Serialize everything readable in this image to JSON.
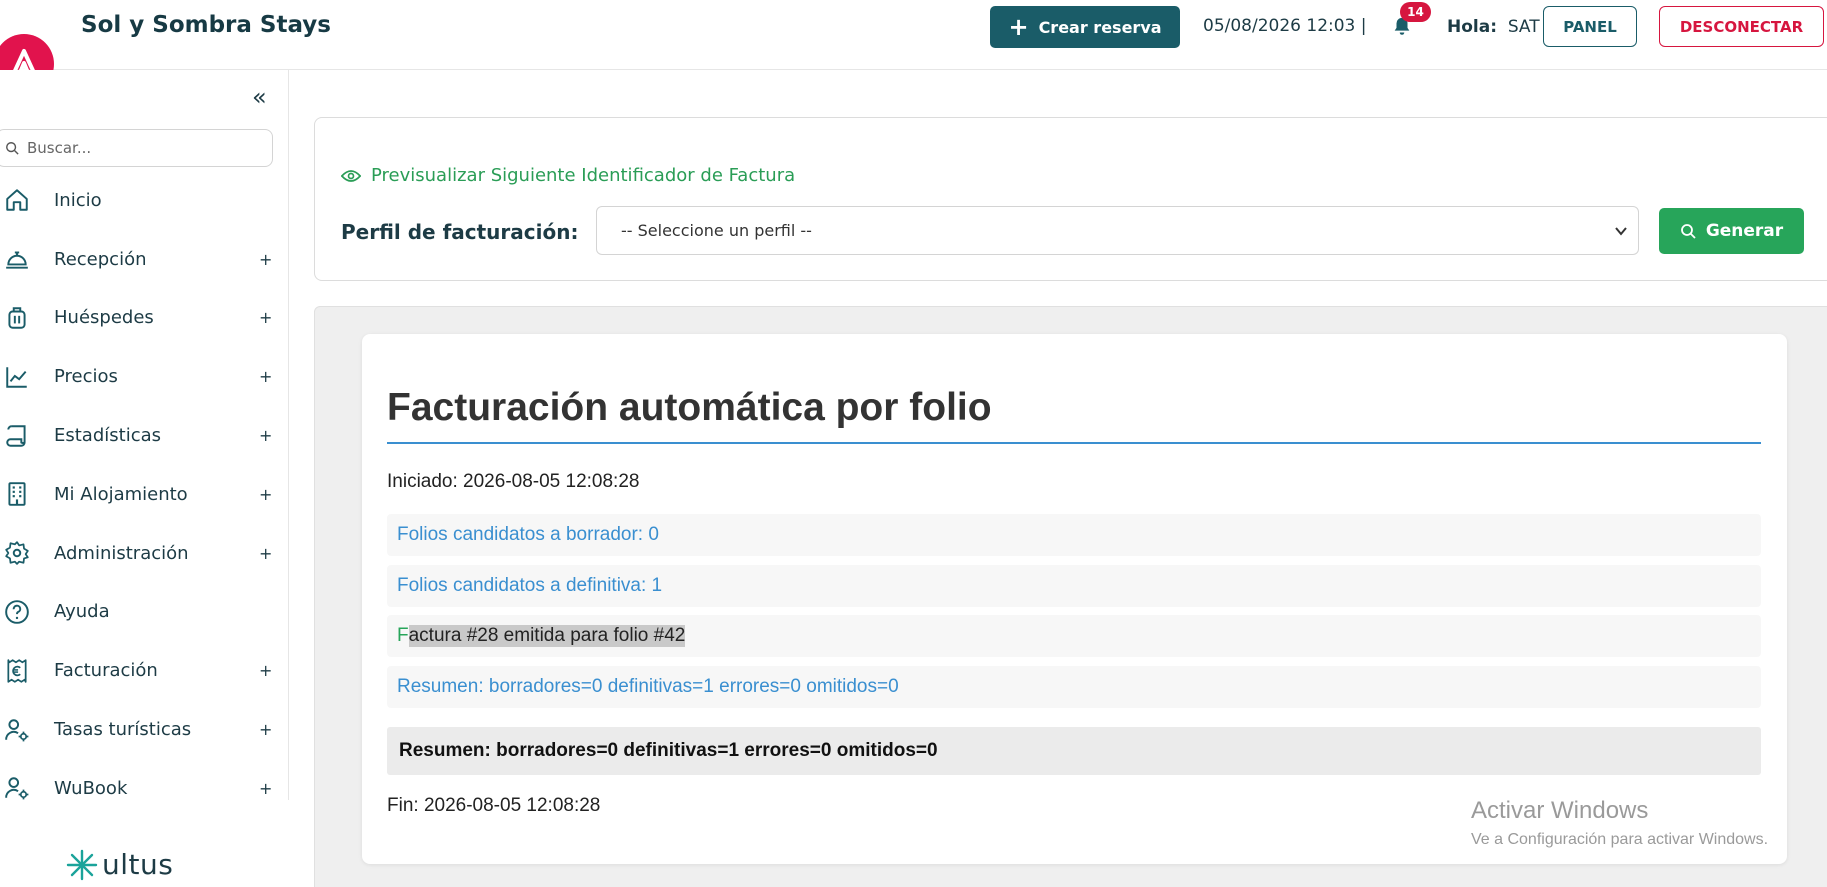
{
  "header": {
    "app_title": "Sol y Sombra Stays",
    "create_button": "Crear reserva",
    "datetime": "05/08/2026 12:03 |",
    "notifications_count": "14",
    "greeting_label": "Hola:",
    "greeting_user": "SAT",
    "panel_button": "PANEL",
    "logout_button": "DESCONECTAR"
  },
  "sidebar": {
    "search_placeholder": "Buscar...",
    "items": [
      {
        "label": "Inicio",
        "icon": "home-icon",
        "expandable": false
      },
      {
        "label": "Recepción",
        "icon": "bell-desk-icon",
        "expandable": true
      },
      {
        "label": "Huéspedes",
        "icon": "luggage-icon",
        "expandable": true
      },
      {
        "label": "Precios",
        "icon": "chart-line-icon",
        "expandable": true
      },
      {
        "label": "Estadísticas",
        "icon": "scroll-icon",
        "expandable": true
      },
      {
        "label": "Mi Alojamiento",
        "icon": "building-icon",
        "expandable": true
      },
      {
        "label": "Administración",
        "icon": "gear-icon",
        "expandable": true
      },
      {
        "label": "Ayuda",
        "icon": "help-circle-icon",
        "expandable": false
      },
      {
        "label": "Facturación",
        "icon": "euro-receipt-icon",
        "expandable": true
      },
      {
        "label": "Tasas turísticas",
        "icon": "user-gear-icon",
        "expandable": true
      },
      {
        "label": "WuBook",
        "icon": "user-gear-icon",
        "expandable": true
      }
    ],
    "expand_symbol": "+",
    "footer_brand": "ultus"
  },
  "preview": {
    "link_text": "Previsualizar Siguiente Identificador de Factura",
    "profile_label": "Perfil de facturación:",
    "profile_selected": "-- Seleccione un perfil --",
    "generate_button": "Generar"
  },
  "results": {
    "title": "Facturación automática por folio",
    "started": "Iniciado: 2026-08-05 12:08:28",
    "lines": [
      "Folios candidatos a borrador: 0",
      "Folios candidatos a definitiva: 1"
    ],
    "emitted_first": "F",
    "emitted_rest": "actura #28 emitida para folio #42",
    "summary_line": "Resumen: borradores=0 definitivas=1 errores=0 omitidos=0",
    "summary_box": "Resumen: borradores=0 definitivas=1 errores=0 omitidos=0",
    "finished": "Fin: 2026-08-05 12:08:28"
  },
  "watermark": {
    "line1": "Activar Windows",
    "line2": "Ve a Configuración para activar Windows."
  },
  "colors": {
    "primary": "#1a5c68",
    "danger": "#d6163f",
    "success": "#27a55a",
    "info": "#3a8fd0"
  }
}
